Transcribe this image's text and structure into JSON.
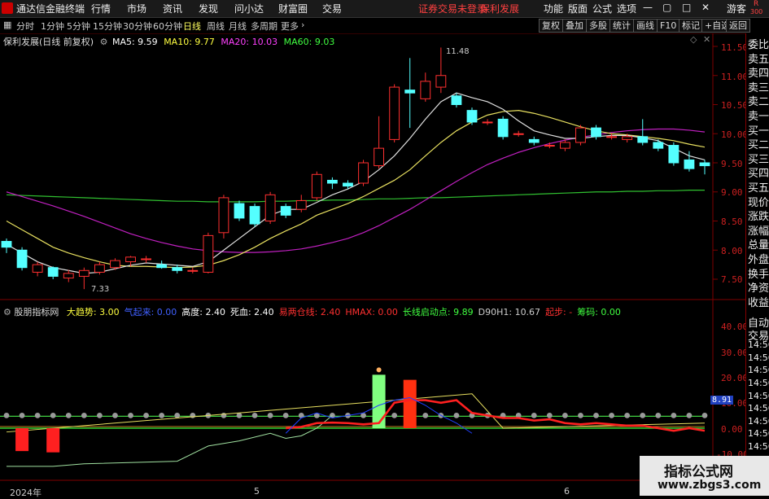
{
  "menu": {
    "app_title": "通达信金融终端",
    "items": [
      "行情",
      "市场",
      "资讯",
      "发现",
      "问小达",
      "财富圈",
      "交易"
    ],
    "notice": "证券交易未登录",
    "stock_name": "保利发展",
    "right_items": [
      "功能",
      "版面",
      "公式",
      "选项"
    ],
    "user": "游客",
    "corner_r": "R",
    "corner_num": "300"
  },
  "periods": {
    "items": [
      "分时",
      "1分钟",
      "5分钟",
      "15分钟",
      "30分钟",
      "60分钟",
      "日线",
      "周线",
      "月线",
      "多周期",
      "更多"
    ],
    "active": "日线",
    "right_buttons": [
      "复权",
      "叠加",
      "多股",
      "统计",
      "画线",
      "F10",
      "标记",
      "+自选",
      "返回"
    ]
  },
  "main_info": {
    "title": "保利发展(日线 前复权)",
    "ma5": "MA5: 9.59",
    "ma10": "MA10: 9.77",
    "ma20": "MA20: 10.03",
    "ma60": "MA60: 9.03",
    "high_label": "11.48",
    "low_label": "7.33"
  },
  "sub_info": {
    "title": "股朋指标网",
    "items": [
      {
        "text": "大趋势: 3.00",
        "color": "#ffff40"
      },
      {
        "text": "气起来: 0.00",
        "color": "#4060ff"
      },
      {
        "text": "高度: 2.40",
        "color": "#ffffff"
      },
      {
        "text": "死血: 2.40",
        "color": "#ffffff"
      },
      {
        "text": "易两仓线: 2.40",
        "color": "#ff3030"
      },
      {
        "text": "HMAX: 0.00",
        "color": "#ff3030"
      },
      {
        "text": "长线启动点: 9.89",
        "color": "#40ff40"
      },
      {
        "text": "D90H1: 10.67",
        "color": "#cccccc"
      },
      {
        "text": "起步: -",
        "color": "#ff3030"
      },
      {
        "text": "筹码: 0.00",
        "color": "#40ff40"
      }
    ]
  },
  "price_axis": [
    "11.50",
    "11.00",
    "10.50",
    "10.00",
    "9.50",
    "9.00",
    "8.50",
    "8.00",
    "7.50"
  ],
  "sub_axis": [
    "40.00",
    "30.00",
    "20.00",
    "10.00",
    "0.00",
    "-10.00"
  ],
  "sub_axis_marker": "8.91",
  "date_labels": [
    {
      "text": "2024年",
      "x": 12
    },
    {
      "text": "5",
      "x": 313
    },
    {
      "text": "6",
      "x": 694
    }
  ],
  "side_panel": [
    "委比",
    "卖五",
    "卖四",
    "卖三",
    "卖二",
    "卖一",
    "买一",
    "买二",
    "买三",
    "买四",
    "买五",
    "现价",
    "涨跌",
    "涨幅",
    "总量",
    "外盘",
    "换手",
    "净资",
    "收益"
  ],
  "side_panel2": [
    "自动",
    "交易",
    "14:56",
    "14:56",
    "14:56",
    "14:56",
    "14:56",
    "14:56",
    "14:56",
    "14:56",
    "14:56"
  ],
  "watermark": {
    "title": "指标公式网",
    "url": "www.zbgs3.com"
  },
  "chart_data": {
    "type": "candlestick",
    "ylim": [
      7.2,
      11.7
    ],
    "candles": [
      {
        "o": 8.15,
        "c": 8.05,
        "h": 8.2,
        "l": 7.95
      },
      {
        "o": 8.0,
        "c": 7.7,
        "h": 8.05,
        "l": 7.65
      },
      {
        "o": 7.62,
        "c": 7.75,
        "h": 7.8,
        "l": 7.55
      },
      {
        "o": 7.7,
        "c": 7.55,
        "h": 7.72,
        "l": 7.5
      },
      {
        "o": 7.52,
        "c": 7.6,
        "h": 7.66,
        "l": 7.45
      },
      {
        "o": 7.55,
        "c": 7.65,
        "h": 7.7,
        "l": 7.33
      },
      {
        "o": 7.62,
        "c": 7.75,
        "h": 7.8,
        "l": 7.58
      },
      {
        "o": 7.7,
        "c": 7.82,
        "h": 7.86,
        "l": 7.66
      },
      {
        "o": 7.8,
        "c": 7.88,
        "h": 7.9,
        "l": 7.72
      },
      {
        "o": 7.85,
        "c": 7.85,
        "h": 7.9,
        "l": 7.78
      },
      {
        "o": 7.75,
        "c": 7.7,
        "h": 7.82,
        "l": 7.68
      },
      {
        "o": 7.7,
        "c": 7.65,
        "h": 7.75,
        "l": 7.6
      },
      {
        "o": 7.65,
        "c": 7.65,
        "h": 7.7,
        "l": 7.6
      },
      {
        "o": 7.62,
        "c": 8.25,
        "h": 8.3,
        "l": 7.6
      },
      {
        "o": 8.3,
        "c": 8.9,
        "h": 8.95,
        "l": 8.2
      },
      {
        "o": 8.8,
        "c": 8.55,
        "h": 8.85,
        "l": 8.5
      },
      {
        "o": 8.75,
        "c": 8.45,
        "h": 8.8,
        "l": 8.4
      },
      {
        "o": 8.5,
        "c": 8.95,
        "h": 9.0,
        "l": 8.45
      },
      {
        "o": 8.75,
        "c": 8.6,
        "h": 8.8,
        "l": 8.55
      },
      {
        "o": 8.7,
        "c": 8.85,
        "h": 8.95,
        "l": 8.65
      },
      {
        "o": 8.9,
        "c": 9.3,
        "h": 9.35,
        "l": 8.85
      },
      {
        "o": 9.2,
        "c": 9.15,
        "h": 9.25,
        "l": 9.05
      },
      {
        "o": 9.15,
        "c": 9.1,
        "h": 9.2,
        "l": 9.05
      },
      {
        "o": 9.15,
        "c": 9.5,
        "h": 9.55,
        "l": 9.1
      },
      {
        "o": 9.45,
        "c": 9.75,
        "h": 10.3,
        "l": 9.4
      },
      {
        "o": 9.9,
        "c": 10.8,
        "h": 10.85,
        "l": 9.85
      },
      {
        "o": 10.75,
        "c": 10.7,
        "h": 11.3,
        "l": 10.1
      },
      {
        "o": 10.6,
        "c": 10.9,
        "h": 11.05,
        "l": 10.55
      },
      {
        "o": 10.8,
        "c": 11.0,
        "h": 11.48,
        "l": 10.7
      },
      {
        "o": 10.65,
        "c": 10.5,
        "h": 10.7,
        "l": 10.45
      },
      {
        "o": 10.4,
        "c": 10.2,
        "h": 10.45,
        "l": 10.15
      },
      {
        "o": 10.2,
        "c": 10.2,
        "h": 10.25,
        "l": 10.15
      },
      {
        "o": 10.25,
        "c": 9.95,
        "h": 10.3,
        "l": 9.9
      },
      {
        "o": 10.0,
        "c": 10.0,
        "h": 10.05,
        "l": 9.95
      },
      {
        "o": 9.9,
        "c": 9.85,
        "h": 9.95,
        "l": 9.8
      },
      {
        "o": 9.8,
        "c": 9.8,
        "h": 9.85,
        "l": 9.75
      },
      {
        "o": 9.75,
        "c": 9.85,
        "h": 9.9,
        "l": 9.7
      },
      {
        "o": 9.85,
        "c": 10.1,
        "h": 10.15,
        "l": 9.8
      },
      {
        "o": 10.1,
        "c": 9.95,
        "h": 10.15,
        "l": 9.9
      },
      {
        "o": 9.95,
        "c": 9.95,
        "h": 10.0,
        "l": 9.9
      },
      {
        "o": 9.9,
        "c": 9.95,
        "h": 10.0,
        "l": 9.85
      },
      {
        "o": 9.95,
        "c": 9.85,
        "h": 10.25,
        "l": 9.8
      },
      {
        "o": 9.85,
        "c": 9.75,
        "h": 9.9,
        "l": 9.7
      },
      {
        "o": 9.8,
        "c": 9.5,
        "h": 9.85,
        "l": 9.45
      },
      {
        "o": 9.55,
        "c": 9.4,
        "h": 9.7,
        "l": 9.35
      },
      {
        "o": 9.5,
        "c": 9.45,
        "h": 9.55,
        "l": 9.3
      }
    ],
    "ma5": [
      8.1,
      7.95,
      7.8,
      7.7,
      7.65,
      7.6,
      7.62,
      7.68,
      7.74,
      7.78,
      7.76,
      7.74,
      7.72,
      7.8,
      8.0,
      8.2,
      8.4,
      8.6,
      8.7,
      8.7,
      8.82,
      8.95,
      9.05,
      9.18,
      9.38,
      9.62,
      9.92,
      10.25,
      10.55,
      10.7,
      10.62,
      10.55,
      10.42,
      10.22,
      10.05,
      9.98,
      9.92,
      9.92,
      9.95,
      9.97,
      9.97,
      9.93,
      9.88,
      9.75,
      9.62,
      9.55
    ],
    "ma10": [
      8.5,
      8.35,
      8.2,
      8.05,
      7.95,
      7.87,
      7.8,
      7.74,
      7.72,
      7.72,
      7.71,
      7.7,
      7.71,
      7.74,
      7.82,
      7.92,
      8.05,
      8.2,
      8.33,
      8.45,
      8.6,
      8.7,
      8.8,
      8.92,
      9.06,
      9.2,
      9.38,
      9.62,
      9.85,
      10.05,
      10.2,
      10.32,
      10.38,
      10.4,
      10.35,
      10.28,
      10.2,
      10.12,
      10.05,
      10.0,
      9.98,
      9.95,
      9.92,
      9.88,
      9.82,
      9.77
    ],
    "ma20": [
      9.0,
      8.92,
      8.84,
      8.76,
      8.67,
      8.58,
      8.48,
      8.38,
      8.28,
      8.2,
      8.13,
      8.07,
      8.02,
      7.99,
      7.97,
      7.96,
      7.96,
      7.97,
      7.99,
      8.02,
      8.07,
      8.13,
      8.2,
      8.3,
      8.42,
      8.56,
      8.7,
      8.86,
      9.02,
      9.18,
      9.33,
      9.47,
      9.58,
      9.68,
      9.76,
      9.83,
      9.89,
      9.94,
      9.98,
      10.02,
      10.05,
      10.07,
      10.08,
      10.08,
      10.06,
      10.03
    ],
    "ma60": [
      8.95,
      8.94,
      8.93,
      8.92,
      8.91,
      8.9,
      8.89,
      8.88,
      8.87,
      8.86,
      8.85,
      8.84,
      8.84,
      8.83,
      8.83,
      8.83,
      8.83,
      8.84,
      8.84,
      8.85,
      8.85,
      8.86,
      8.86,
      8.87,
      8.88,
      8.88,
      8.89,
      8.9,
      8.9,
      8.91,
      8.92,
      8.93,
      8.94,
      8.95,
      8.96,
      8.97,
      8.98,
      8.99,
      9.0,
      9.0,
      9.01,
      9.01,
      9.02,
      9.02,
      9.03,
      9.03
    ],
    "sub": {
      "ylim": [
        -12,
        45
      ],
      "green_baseline": 0,
      "gray_level": 5,
      "red_bars": [
        {
          "i": 1,
          "top": 0,
          "bottom": -9
        },
        {
          "i": 3,
          "top": 0,
          "bottom": -9.5
        }
      ],
      "green_bar": {
        "i": 24,
        "top": 21,
        "bottom": 0
      },
      "red_bar": {
        "i": 26,
        "top": 19,
        "bottom": 0
      },
      "yellow_line": [
        [
          0,
          -1.5
        ],
        [
          30,
          13.5
        ],
        [
          32,
          0
        ],
        [
          45,
          2
        ]
      ],
      "white_line": [
        [
          0,
          -15
        ],
        [
          3,
          -15
        ],
        [
          5,
          -14
        ],
        [
          11,
          -13
        ],
        [
          13,
          -7
        ],
        [
          15,
          -5
        ],
        [
          17,
          -2
        ],
        [
          18,
          -4
        ],
        [
          19,
          -3
        ],
        [
          20,
          0
        ],
        [
          21,
          5
        ]
      ],
      "red_line": [
        [
          18,
          0
        ],
        [
          19,
          0.5
        ],
        [
          20,
          2
        ],
        [
          21,
          2.2
        ],
        [
          22,
          2
        ],
        [
          23,
          1.5
        ],
        [
          24,
          2
        ],
        [
          25,
          10
        ],
        [
          26,
          11
        ],
        [
          27,
          11
        ],
        [
          28,
          10
        ],
        [
          29,
          11
        ],
        [
          30,
          6
        ],
        [
          31,
          5
        ],
        [
          32,
          4
        ],
        [
          33,
          4
        ],
        [
          34,
          3
        ],
        [
          35,
          3.5
        ],
        [
          36,
          2
        ],
        [
          37,
          1.5
        ],
        [
          38,
          2
        ],
        [
          39,
          1.5
        ],
        [
          40,
          1
        ],
        [
          41,
          1
        ],
        [
          42,
          0
        ],
        [
          43,
          -1
        ],
        [
          44,
          0
        ],
        [
          45,
          -1
        ]
      ]
    }
  }
}
